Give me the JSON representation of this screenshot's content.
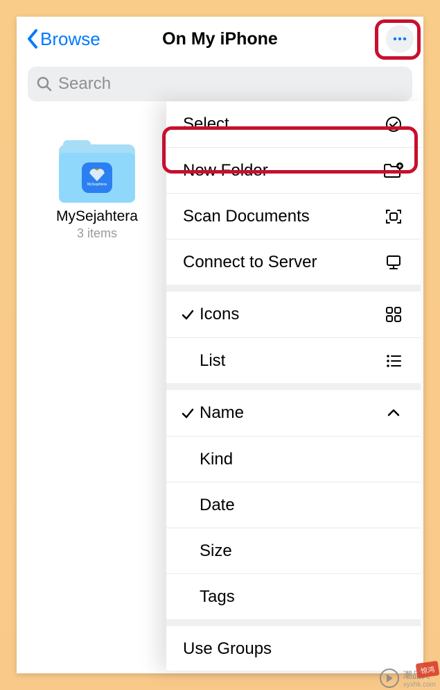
{
  "nav": {
    "back_label": "Browse",
    "title": "On My iPhone"
  },
  "search": {
    "placeholder": "Search"
  },
  "folders": [
    {
      "name": "MySejahtera",
      "count": "3 items",
      "app_label": "MySejahtera"
    }
  ],
  "menu": {
    "groups": [
      {
        "items": [
          {
            "label": "Select",
            "icon": "select-circle"
          },
          {
            "label": "New Folder",
            "icon": "folder-plus"
          },
          {
            "label": "Scan Documents",
            "icon": "scan"
          },
          {
            "label": "Connect to Server",
            "icon": "server"
          }
        ]
      },
      {
        "items": [
          {
            "label": "Icons",
            "icon": "grid",
            "checked": true
          },
          {
            "label": "List",
            "icon": "list",
            "checked": false
          }
        ]
      },
      {
        "items": [
          {
            "label": "Name",
            "icon": "chevron-up",
            "checked": true
          },
          {
            "label": "Kind",
            "checked": false
          },
          {
            "label": "Date",
            "checked": false
          },
          {
            "label": "Size",
            "checked": false
          },
          {
            "label": "Tags",
            "checked": false
          }
        ]
      },
      {
        "items": [
          {
            "label": "Use Groups"
          }
        ]
      }
    ]
  },
  "watermark": {
    "text": "潮品文",
    "sub": "xyxhk.com",
    "badge": "惊鸿"
  }
}
